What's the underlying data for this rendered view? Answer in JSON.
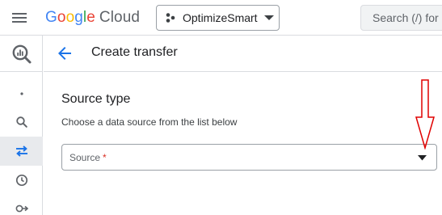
{
  "topbar": {
    "logo_google": [
      "G",
      "o",
      "o",
      "g",
      "l",
      "e"
    ],
    "logo_cloud": "Cloud",
    "project_name": "OptimizeSmart",
    "search_placeholder": "Search (/) for"
  },
  "rail": {
    "items": [
      {
        "icon": "bigquery-icon"
      },
      {
        "icon": "dot-icon"
      },
      {
        "icon": "search-icon"
      },
      {
        "icon": "transfers-icon",
        "active": true
      },
      {
        "icon": "schedule-icon"
      },
      {
        "icon": "connections-icon"
      }
    ]
  },
  "header": {
    "title": "Create transfer"
  },
  "main": {
    "section_title": "Source type",
    "section_desc": "Choose a data source from the list below",
    "source_label": "Source",
    "required_mark": "*"
  },
  "colors": {
    "google_blue": "#4285F4",
    "google_red": "#EA4335",
    "google_yellow": "#FBBC05",
    "google_green": "#34A853",
    "accent_blue": "#1a73e8",
    "annotation_red": "#e00000"
  }
}
